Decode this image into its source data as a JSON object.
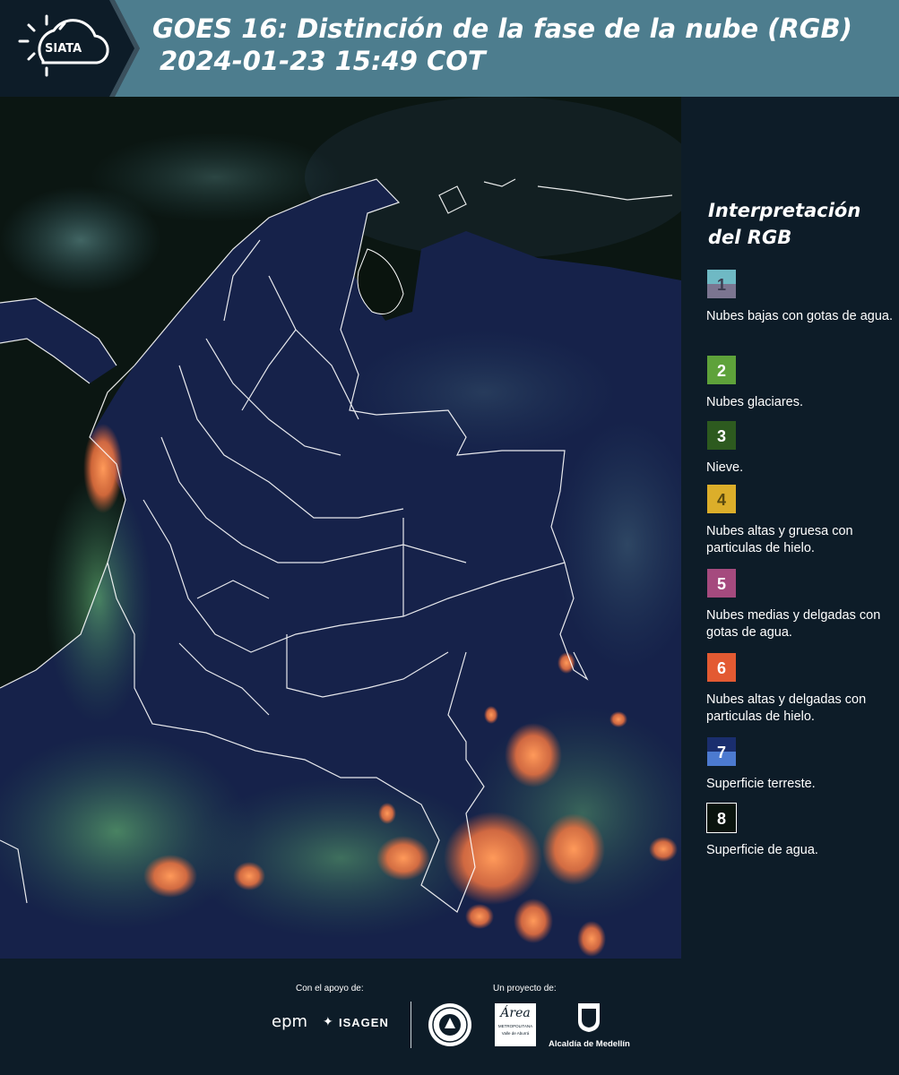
{
  "header": {
    "logo_text": "SIATA",
    "title_line1": "GOES 16: Distinción de la fase de la nube (RGB)",
    "title_line2": "2024-01-23 15:49 COT"
  },
  "legend": {
    "title_line1": "Interpretación",
    "title_line2": "del RGB",
    "items": [
      {
        "num": "1",
        "label": "Nubes bajas con gotas de agua.",
        "color_top": "#6fb9c4",
        "color_bottom": "#7b7590",
        "num_color": "#3c3c50"
      },
      {
        "num": "2",
        "label": "Nubes glaciares.",
        "color_top": "#5ea23a",
        "color_bottom": "#5ea23a",
        "num_color": "#ffffff"
      },
      {
        "num": "3",
        "label": "Nieve.",
        "color_top": "#2d5a1f",
        "color_bottom": "#2d5a1f",
        "num_color": "#ffffff"
      },
      {
        "num": "4",
        "label": "Nubes altas y gruesa con particulas de hielo.",
        "color_top": "#dcae2a",
        "color_bottom": "#dcae2a",
        "num_color": "#5a4a10"
      },
      {
        "num": "5",
        "label": "Nubes medias y delgadas con gotas de agua.",
        "color_top": "#a54a7e",
        "color_bottom": "#a54a7e",
        "num_color": "#ffffff"
      },
      {
        "num": "6",
        "label": "Nubes altas y delgadas con particulas de hielo.",
        "color_top": "#e35a32",
        "color_bottom": "#e35a32",
        "num_color": "#ffffff"
      },
      {
        "num": "7",
        "label": "Superficie terreste.",
        "color_top": "#1a2e6e",
        "color_bottom": "#4c7ad0",
        "num_color": "#ffffff"
      },
      {
        "num": "8",
        "label": "Superficie de agua.",
        "color_top": "#0a140e",
        "color_bottom": "#0a140e",
        "num_color": "#ffffff"
      }
    ]
  },
  "footer": {
    "support_label": "Con el apoyo de:",
    "project_label": "Un proyecto de:",
    "sponsor1": "epm",
    "sponsor2": "ISAGEN",
    "partner_area_word": "Área",
    "partner_area_sub": "METROPOLITANA",
    "partner_area_sub2": "Valle de Aburrá",
    "partner_alcaldia": "Alcaldía de Medellín"
  },
  "colors": {
    "header_bg": "#4d7d8e",
    "page_bg": "#0d1c28",
    "cloud_ice": "#ff8a4a",
    "land": "#17244a",
    "ocean": "#0a1410"
  }
}
